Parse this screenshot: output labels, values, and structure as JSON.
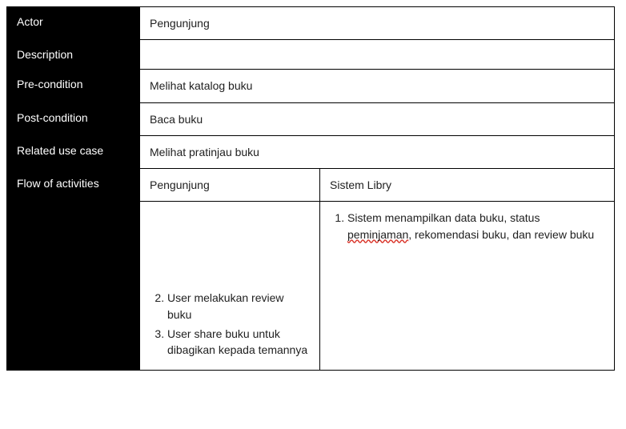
{
  "rows": {
    "actor": {
      "label": "Actor",
      "value": "Pengunjung"
    },
    "description": {
      "label": "Description",
      "value": ""
    },
    "precondition": {
      "label": "Pre-condition",
      "value": "Melihat katalog buku"
    },
    "postcondition": {
      "label": "Post-condition",
      "value": "Baca buku"
    },
    "related": {
      "label": "Related use case",
      "value": "Melihat pratinjau buku"
    }
  },
  "flow": {
    "label": "Flow of activities",
    "cols": {
      "left": "Pengunjung",
      "right": "Sistem Libry"
    },
    "left_steps": {
      "s2": "User melakukan review buku",
      "s3": "User share buku untuk dibagikan kepada temannya"
    },
    "right_steps": {
      "prefix": "Sistem menampilkan data buku, status ",
      "spell": "peminjaman",
      "suffix": ", rekomendasi buku, dan review buku"
    }
  }
}
